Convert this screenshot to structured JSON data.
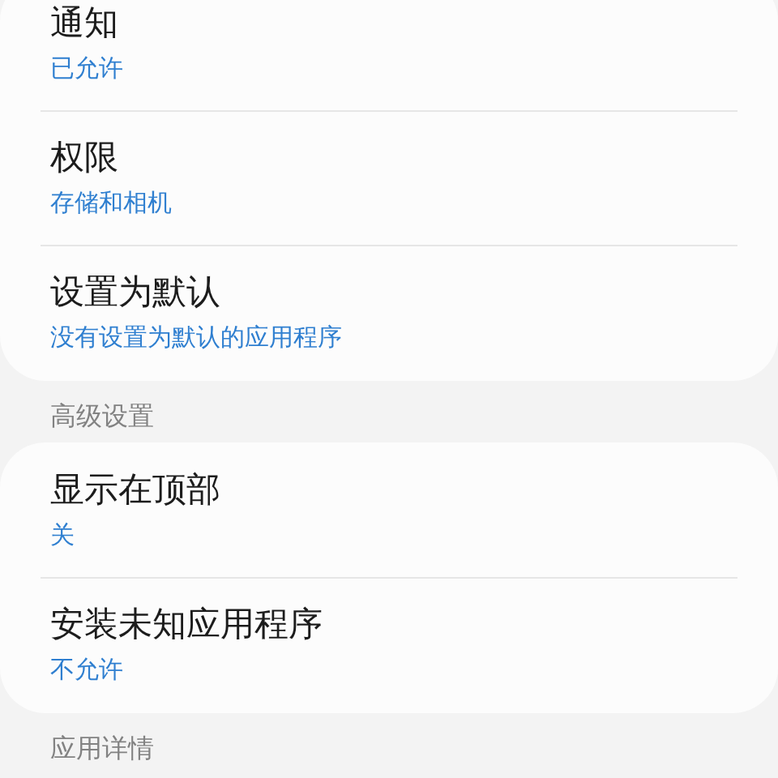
{
  "sections": [
    {
      "items": [
        {
          "title": "通知",
          "value": "已允许"
        },
        {
          "title": "权限",
          "value": "存储和相机"
        },
        {
          "title": "设置为默认",
          "value": "没有设置为默认的应用程序"
        }
      ]
    },
    {
      "header": "高级设置",
      "items": [
        {
          "title": "显示在顶部",
          "value": "关"
        },
        {
          "title": "安装未知应用程序",
          "value": "不允许"
        }
      ]
    },
    {
      "header": "应用详情"
    }
  ]
}
